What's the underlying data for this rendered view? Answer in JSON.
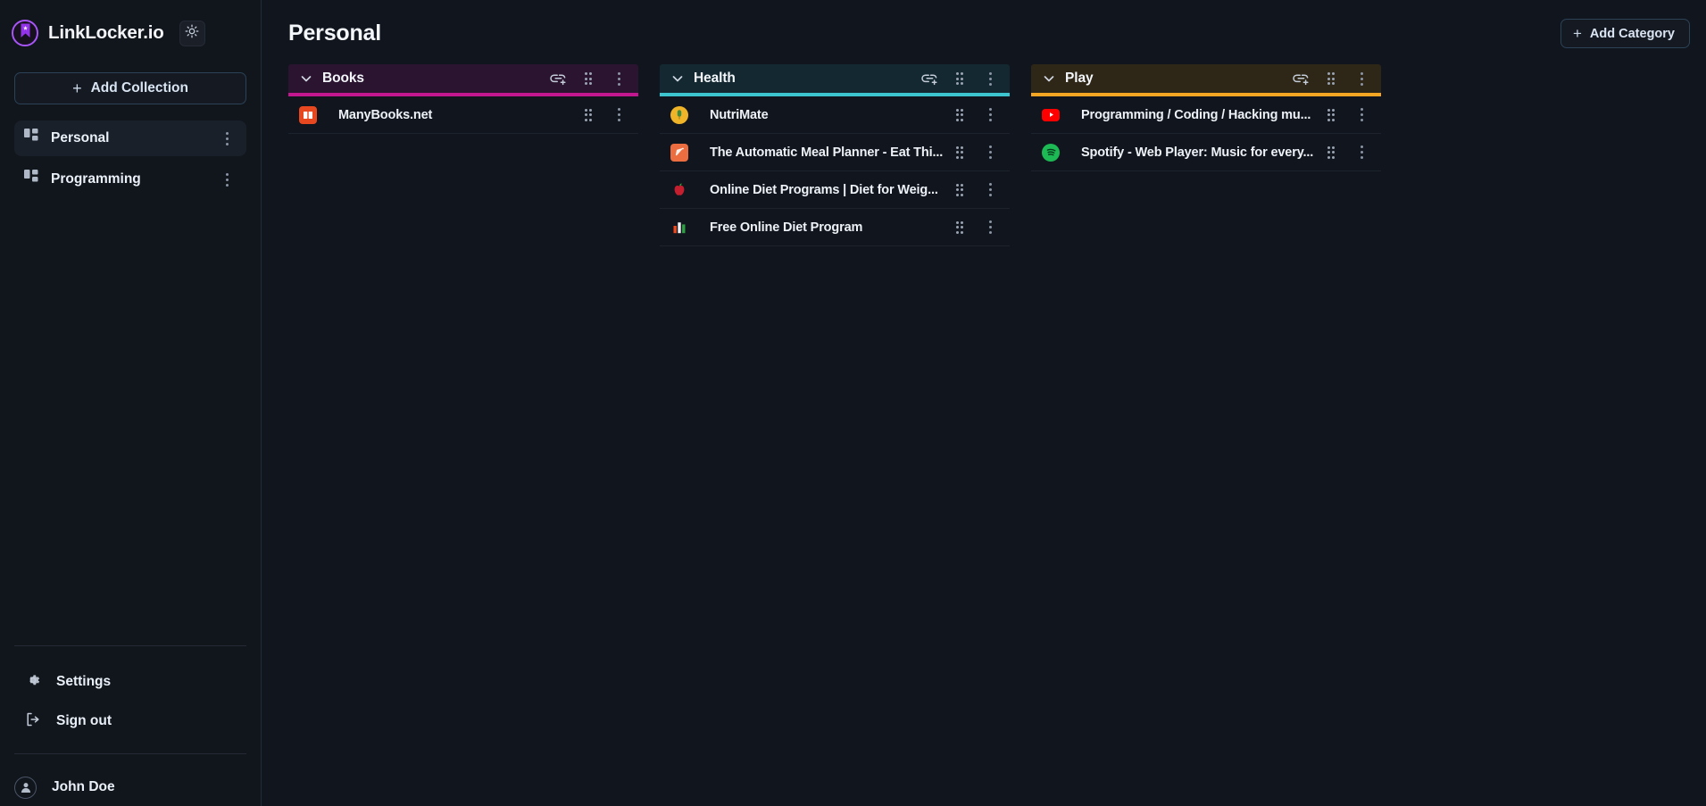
{
  "app": {
    "brand_name": "LinkLocker.io",
    "logo_icon": "bookmark-star-icon",
    "theme_toggle_icon": "sun-icon"
  },
  "sidebar": {
    "add_collection": {
      "label": "Add Collection",
      "icon": "plus-icon"
    },
    "collections": [
      {
        "label": "Personal",
        "icon": "grid-icon",
        "active": true,
        "menu_icon": "kebab-menu-icon"
      },
      {
        "label": "Programming",
        "icon": "grid-icon",
        "active": false,
        "menu_icon": "kebab-menu-icon"
      }
    ],
    "bottom_nav": [
      {
        "label": "Settings",
        "icon": "gear-icon"
      },
      {
        "label": "Sign out",
        "icon": "sign-out-icon"
      }
    ],
    "user": {
      "name": "John Doe",
      "icon": "user-avatar-icon"
    }
  },
  "header": {
    "title": "Personal",
    "add_category": {
      "label": "Add Category",
      "icon": "plus-icon"
    }
  },
  "board": {
    "row_icons": {
      "drag_icon": "drag-handle-icon",
      "menu_icon": "kebab-menu-icon"
    },
    "head_icons": {
      "collapse_icon": "chevron-down-icon",
      "add_link_icon": "link-plus-icon",
      "drag_icon": "drag-handle-icon",
      "menu_icon": "kebab-menu-icon"
    },
    "columns": [
      {
        "name": "Books",
        "accent": "#c2178f",
        "header_bg": "#2b1430",
        "links": [
          {
            "title": "ManyBooks.net",
            "favicon": "manybooks-icon",
            "favicon_color": "#e8481f"
          }
        ]
      },
      {
        "name": "Health",
        "accent": "#3cc4cf",
        "header_bg": "#132830",
        "links": [
          {
            "title": "NutriMate",
            "favicon": "nutrimate-icon",
            "favicon_color": "#f0b429"
          },
          {
            "title": "The Automatic Meal Planner - Eat Thi...",
            "favicon": "carrot-icon",
            "favicon_color": "#ec6d3f"
          },
          {
            "title": "Online Diet Programs | Diet for Weig...",
            "favicon": "apple-icon",
            "favicon_color": "#c41f2e"
          },
          {
            "title": "Free Online Diet Program",
            "favicon": "bar-chart-icon",
            "favicon_color": "#e8491f"
          }
        ]
      },
      {
        "name": "Play",
        "accent": "#f5a623",
        "header_bg": "#2e2616",
        "links": [
          {
            "title": "Programming / Coding / Hacking mu...",
            "favicon": "youtube-icon",
            "favicon_color": "#ff0000"
          },
          {
            "title": "Spotify - Web Player: Music for every...",
            "favicon": "spotify-icon",
            "favicon_color": "#1db954"
          }
        ]
      }
    ]
  }
}
